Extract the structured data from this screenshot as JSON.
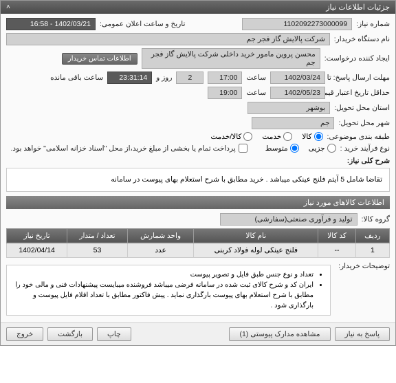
{
  "header": {
    "title": "جزئیات اطلاعات نیاز",
    "collapse_icon": "˄"
  },
  "fields": {
    "niaz_no_label": "شماره نیاز:",
    "niaz_no": "1102092273000099",
    "announce_label": "تاریخ و ساعت اعلان عمومی:",
    "announce_value": "1402/03/21 - 16:58",
    "buyer_label": "نام دستگاه خریدار:",
    "buyer_value": "شرکت پالایش گاز فجر جم",
    "creator_label": "ایجاد کننده درخواست:",
    "creator_value": "محسن پروین مامور خرید داخلی شرکت پالایش گاز فجر جم",
    "contact_btn": "اطلاعات تماس خریدار",
    "deadline_label": "مهلت ارسال پاسخ: تا تاریخ:",
    "deadline_date": "1402/03/24",
    "time_label": "ساعت",
    "deadline_time": "17:00",
    "day_label": "روز و",
    "days_left": "2",
    "remain_time": "23:31:14",
    "remain_label": "ساعت باقی مانده",
    "validity_label": "حداقل تاریخ اعتبار قیمت: تا تاریخ:",
    "validity_date": "1402/05/23",
    "validity_time": "19:00",
    "province_label": "استان محل تحویل:",
    "province_value": "بوشهر",
    "city_label": "شهر محل تحویل:",
    "city_value": "جم",
    "category_label": "طبقه بندی موضوعی:",
    "cat_kala": "کالا",
    "cat_khadamat": "خدمت",
    "cat_kalakhadamat": "کالا/خدمت",
    "buytype_label": "نوع فرآیند خرید :",
    "bt_jozi": "جزیی",
    "bt_motevaset": "متوسط",
    "payment_note": "پرداخت تمام یا بخشی از مبلغ خرید،از محل \"اسناد خزانه اسلامی\" خواهد بود.",
    "desc_label": "شرح کلی نیاز:",
    "desc_text": "تقاضا شامل 5 آیتم فلنج عینکی میباشد . خرید مطابق با شرح استعلام بهای پیوست در سامانه",
    "items_header": "اطلاعات کالاهای مورد نیاز",
    "group_label": "گروه کالا:",
    "group_value": "تولید و فرآوری صنعتی(سفارشی)",
    "buyer_notes_label": "توضیحات خریدار:",
    "notes_1": "تعداد و نوع جنس طبق فایل و تصویر پیوست",
    "notes_2": "ایران کد و شرح کالای ثبت شده در سامانه فرضی میباشد فروشنده میبایست پیشنهادات فنی و مالی  خود  را مطابق با شرح  استعلام بهای پیوست بارگذاری نماید . پیش فاکتور مطابق با تعداد اقلام فایل پیوست و بارگذاری شود ."
  },
  "table": {
    "headers": {
      "row": "ردیف",
      "code": "کد کالا",
      "name": "نام کالا",
      "unit": "واحد شمارش",
      "qty": "تعداد / متدار",
      "date": "تاریخ نیاز"
    },
    "rows": [
      {
        "row": "1",
        "code": "--",
        "name": "فلنج عینکی لوله فولاد کربنی",
        "unit": "عدد",
        "qty": "53",
        "date": "1402/04/14"
      }
    ]
  },
  "footer": {
    "respond": "پاسخ به نیاز",
    "attachments": "مشاهده مدارک پیوستی (1)",
    "print": "چاپ",
    "back": "بازگشت",
    "exit": "خروج"
  }
}
